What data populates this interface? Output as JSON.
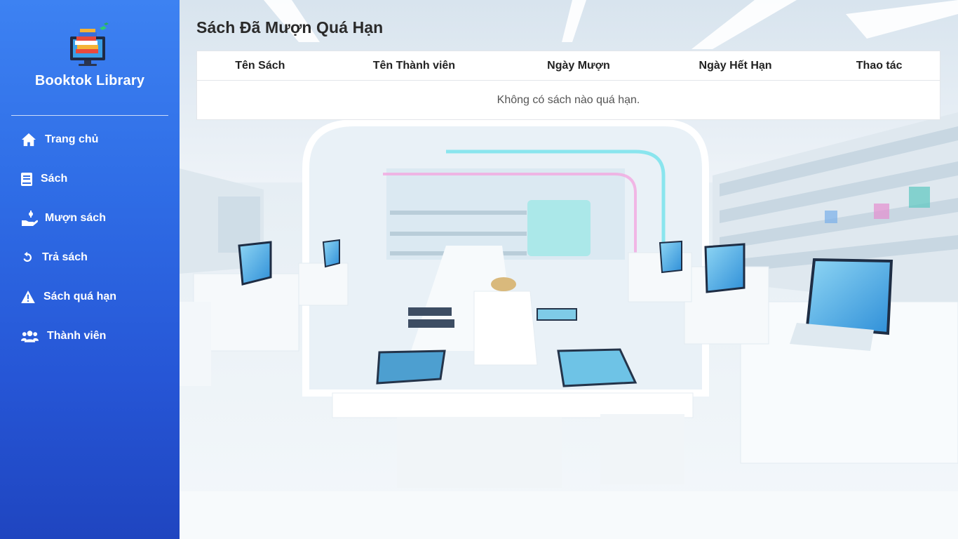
{
  "sidebar": {
    "brand": "Booktok Library",
    "logo_icon": "library-logo-icon",
    "items": [
      {
        "label": "Trang chủ",
        "icon": "home-icon"
      },
      {
        "label": "Sách",
        "icon": "book-icon"
      },
      {
        "label": "Mượn sách",
        "icon": "hand-borrow-icon"
      },
      {
        "label": "Trả sách",
        "icon": "undo-icon"
      },
      {
        "label": "Sách quá hạn",
        "icon": "warning-icon"
      },
      {
        "label": "Thành viên",
        "icon": "users-icon"
      }
    ]
  },
  "main": {
    "title": "Sách Đã Mượn Quá Hạn",
    "table": {
      "headers": [
        "Tên Sách",
        "Tên Thành viên",
        "Ngày Mượn",
        "Ngày Hết Hạn",
        "Thao tác"
      ],
      "empty_message": "Không có sách nào quá hạn.",
      "rows": []
    }
  },
  "colors": {
    "sidebar_top": "#3d82f2",
    "sidebar_bottom": "#1f45c0",
    "text_dark": "#2a2a2a"
  }
}
